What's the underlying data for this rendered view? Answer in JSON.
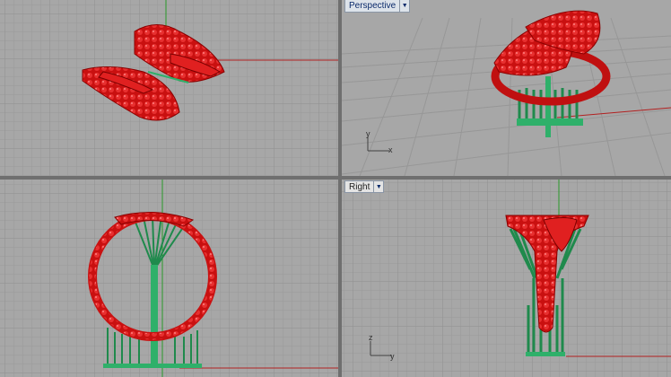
{
  "viewports": {
    "perspective": {
      "title": "Perspective",
      "axis_x": "x",
      "axis_y": "y"
    },
    "right": {
      "title": "Right",
      "axis_z": "z",
      "axis_y": "y"
    }
  },
  "colors": {
    "model": "#d81414",
    "supports": "#2fb06a",
    "grid": "#989898",
    "background": "#a7a7a7",
    "axis_red": "#b22020",
    "axis_green": "#2a9a2a"
  },
  "icons": {
    "dropdown": "chevron-down-icon"
  }
}
